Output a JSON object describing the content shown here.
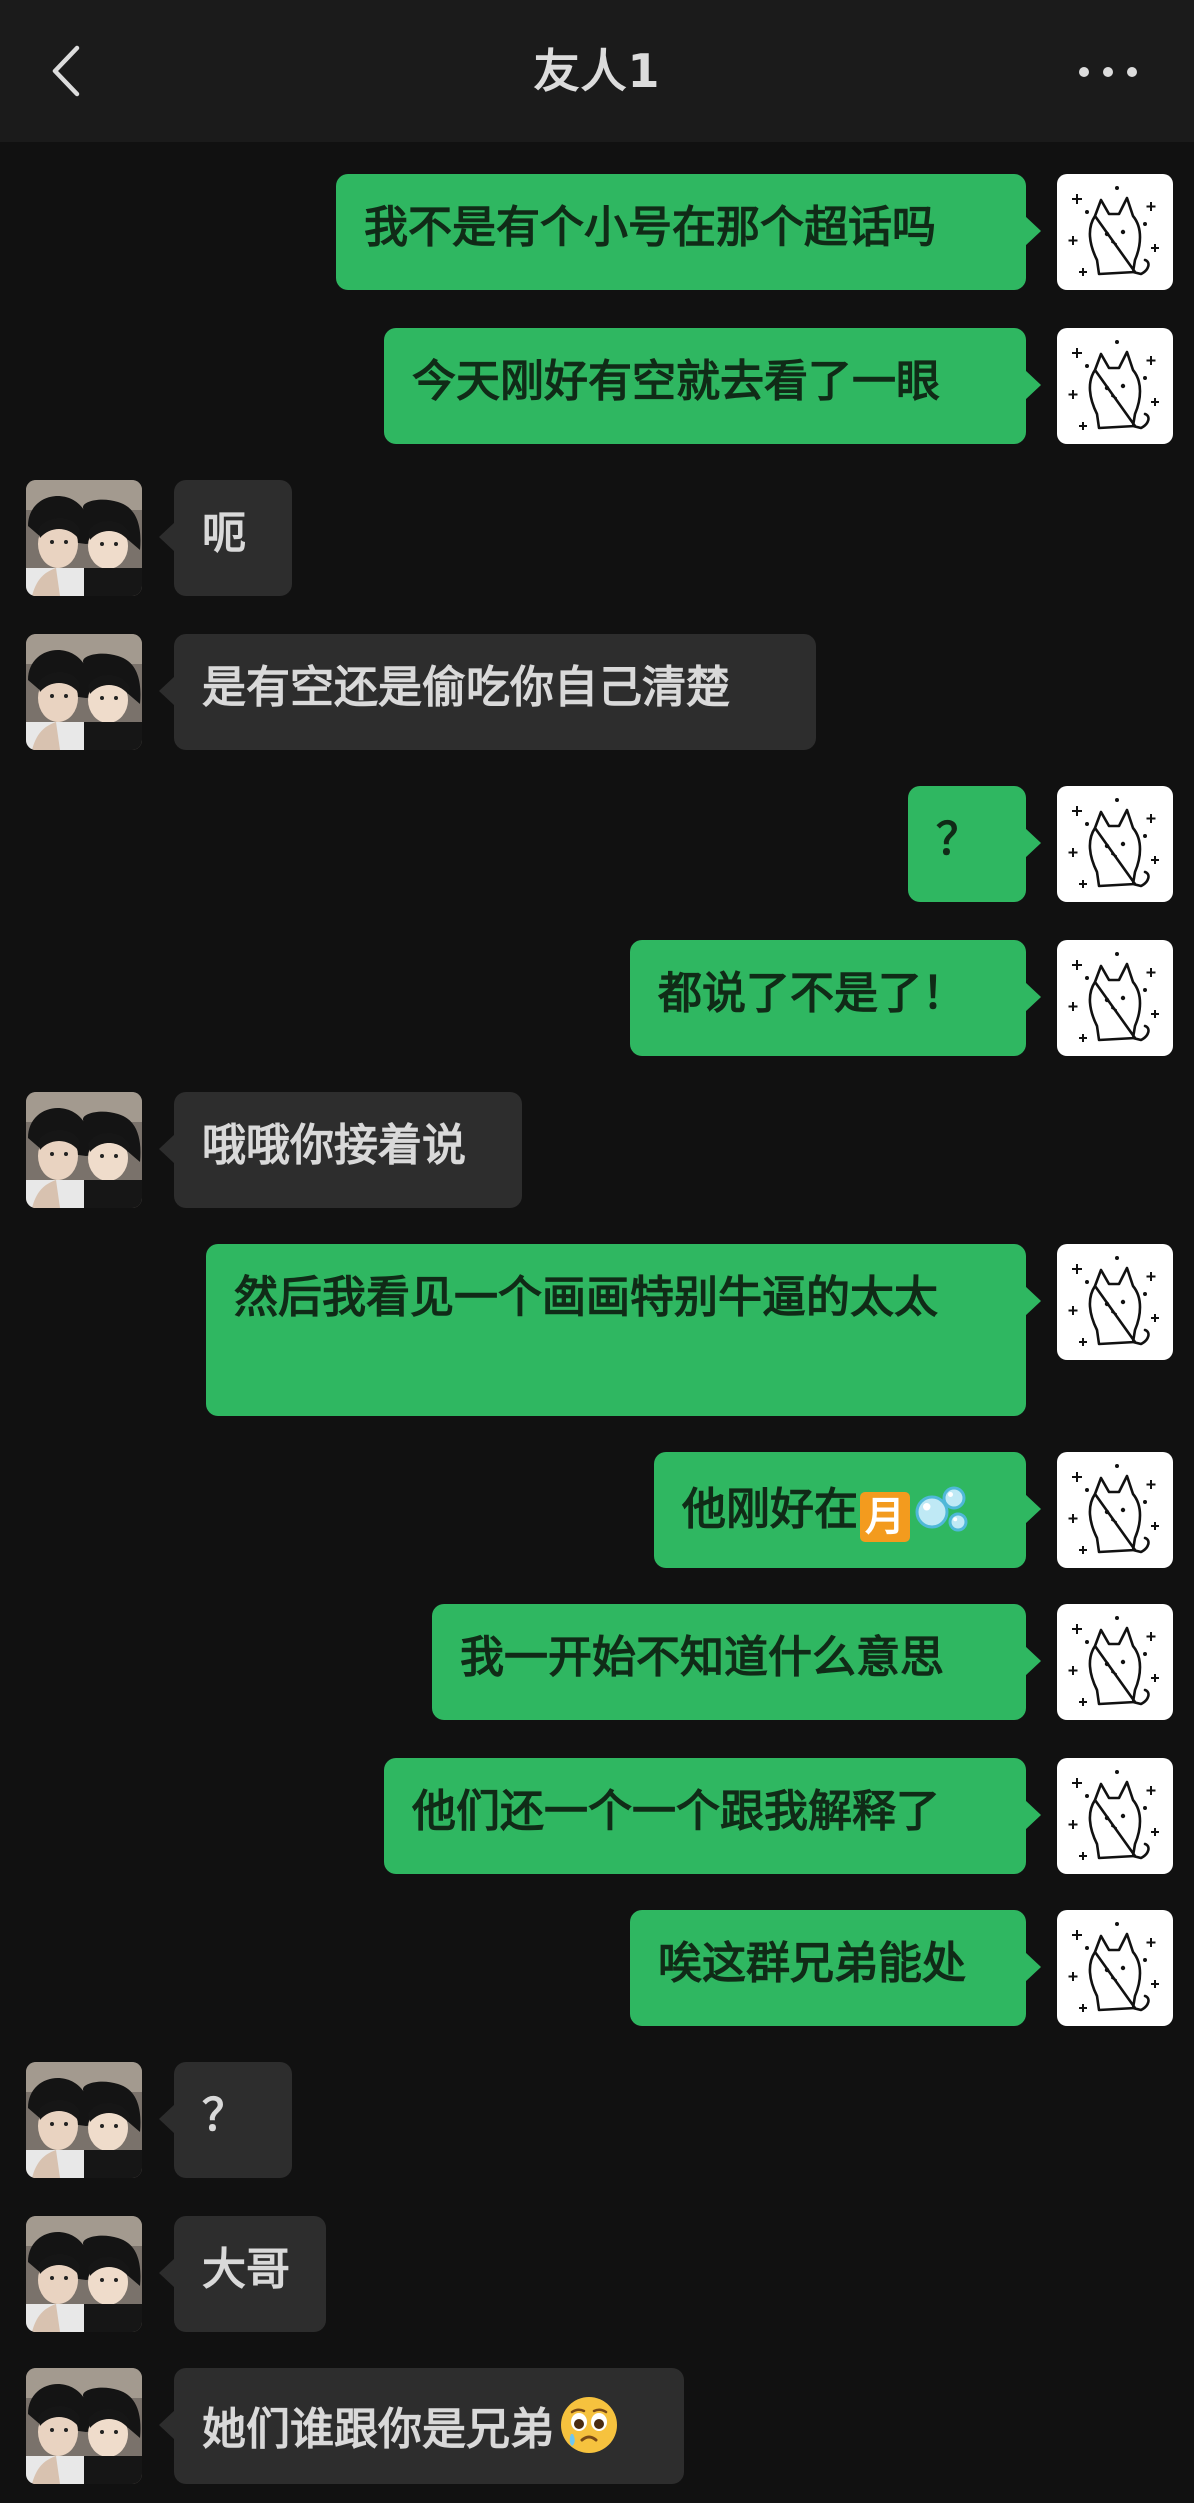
{
  "header": {
    "title": "友人1"
  },
  "icons": {
    "back": "chevron-left-icon",
    "more": "more-horizontal-icon",
    "moon": "moon-emoji-icon",
    "bubbles": "bubbles-emoji-icon",
    "face": "pleading-face-emoji-icon"
  },
  "colors": {
    "self_bubble": "#2fb761",
    "friend_bubble": "#2d2d2d",
    "background": "#111111",
    "header": "#1b1b1b"
  },
  "messages": [
    {
      "sender": "self",
      "text": "我不是有个小号在那个超话吗"
    },
    {
      "sender": "self",
      "text": "今天刚好有空就去看了一眼"
    },
    {
      "sender": "friend",
      "text": "呃"
    },
    {
      "sender": "friend",
      "text": "是有空还是偷吃你自己清楚"
    },
    {
      "sender": "self",
      "text": "？"
    },
    {
      "sender": "self",
      "text": "都说了不是了！"
    },
    {
      "sender": "friend",
      "text": "哦哦你接着说"
    },
    {
      "sender": "self",
      "text": "然后我看见一个画画特别牛逼的太太"
    },
    {
      "sender": "self",
      "text": "他刚好在",
      "moon_char": "月"
    },
    {
      "sender": "self",
      "text": "我一开始不知道什么意思"
    },
    {
      "sender": "self",
      "text": "他们还一个一个跟我解释了"
    },
    {
      "sender": "self",
      "text": "唉这群兄弟能处"
    },
    {
      "sender": "friend",
      "text": "？"
    },
    {
      "sender": "friend",
      "text": "大哥"
    },
    {
      "sender": "friend",
      "text": "她们谁跟你是兄弟"
    }
  ]
}
